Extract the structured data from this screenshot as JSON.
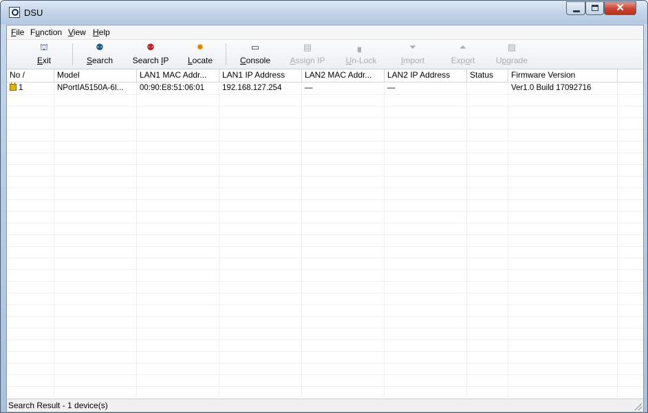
{
  "window": {
    "title": "DSU"
  },
  "menu": [
    {
      "pre": "",
      "u": "F",
      "post": "ile"
    },
    {
      "pre": "F",
      "u": "u",
      "post": "nction"
    },
    {
      "pre": "",
      "u": "V",
      "post": "iew"
    },
    {
      "pre": "",
      "u": "H",
      "post": "elp"
    }
  ],
  "toolbar": [
    {
      "pre": "",
      "u": "E",
      "post": "xit",
      "icon": "exit-icon",
      "enabled": true
    },
    {
      "pre": "",
      "u": "S",
      "post": "earch",
      "icon": "search-icon",
      "enabled": true
    },
    {
      "pre": "Search ",
      "u": "I",
      "post": "P",
      "icon": "search-ip-icon",
      "enabled": true
    },
    {
      "pre": "",
      "u": "L",
      "post": "ocate",
      "icon": "locate-icon",
      "enabled": true
    },
    {
      "pre": "",
      "u": "C",
      "post": "onsole",
      "icon": "console-icon",
      "enabled": true
    },
    {
      "pre": "",
      "u": "A",
      "post": "ssign IP",
      "icon": "assign-ip-icon",
      "enabled": false
    },
    {
      "pre": "",
      "u": "U",
      "post": "n-Lock",
      "icon": "unlock-icon",
      "enabled": false
    },
    {
      "pre": "",
      "u": "I",
      "post": "mport",
      "icon": "import-icon",
      "enabled": false
    },
    {
      "pre": "Exp",
      "u": "o",
      "post": "rt",
      "icon": "export-icon",
      "enabled": false
    },
    {
      "pre": "U",
      "u": "p",
      "post": "grade",
      "icon": "upgrade-icon",
      "enabled": false
    }
  ],
  "table": {
    "columns": [
      "No  /",
      "Model",
      "LAN1 MAC Addr...",
      "LAN1 IP Address",
      "LAN2 MAC Addr...",
      "LAN2 IP Address",
      "Status",
      "Firmware Version"
    ],
    "rows": [
      [
        "1",
        "NPortIA5150A-6I...",
        "00:90:E8:51:06:01",
        "192.168.127.254",
        "—",
        "—",
        "",
        "Ver1.0 Build 17092716"
      ]
    ]
  },
  "status": {
    "text": "Search Result - 1 device(s)"
  },
  "colors": {
    "lock": "#e0b400",
    "close_button": "#c9432f"
  }
}
